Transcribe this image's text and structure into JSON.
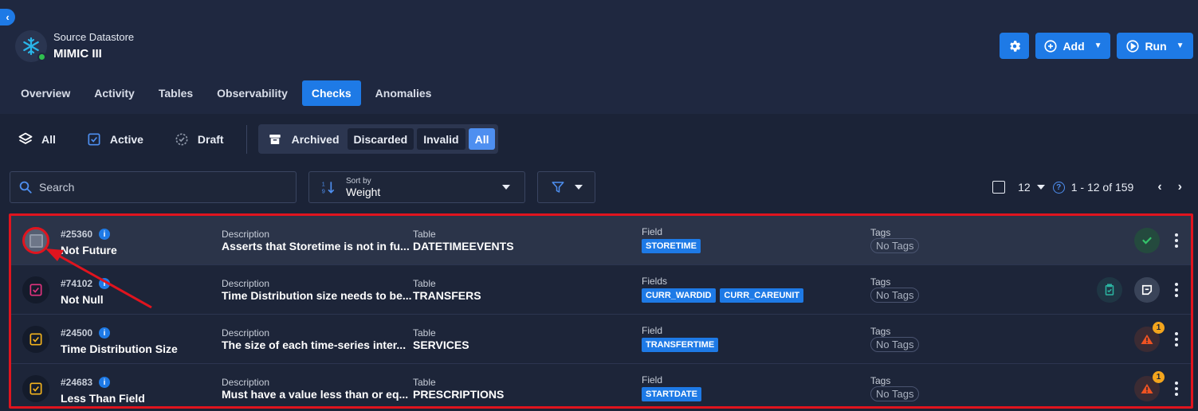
{
  "nav": {
    "back_icon": "chevron-left-icon"
  },
  "datastore": {
    "type_label": "Source Datastore",
    "name": "MIMIC III",
    "logo_icon": "snowflake-icon",
    "status_color": "#2fbf4f"
  },
  "actions": {
    "settings_icon": "gear-icon",
    "add_label": "Add",
    "run_label": "Run",
    "accent": "#1e7ae6"
  },
  "tabs": [
    {
      "label": "Overview"
    },
    {
      "label": "Activity"
    },
    {
      "label": "Tables"
    },
    {
      "label": "Observability"
    },
    {
      "label": "Checks",
      "active": true
    },
    {
      "label": "Anomalies"
    }
  ],
  "status_filters": {
    "all": "All",
    "active": "Active",
    "draft": "Draft",
    "archived": "Archived",
    "archived_options": [
      "Discarded",
      "Invalid",
      "All"
    ],
    "archived_selected": "All"
  },
  "search": {
    "placeholder": "Search"
  },
  "sort": {
    "caption": "Sort by",
    "value": "Weight"
  },
  "pagination": {
    "per_page": "12",
    "range": "1 - 12 of 159"
  },
  "checks": [
    {
      "id": "#25360",
      "name": "Not Future",
      "desc_label": "Description",
      "description": "Asserts that Storetime is not in fu...",
      "table_label": "Table",
      "table": "DATETIMEEVENTS",
      "field_label": "Field",
      "fields": [
        "STORETIME"
      ],
      "tags_label": "Tags",
      "tags": "No Tags",
      "status": "passed",
      "icon": "checkbox-icon"
    },
    {
      "id": "#74102",
      "name": "Not Null",
      "desc_label": "Description",
      "description": "Time Distribution size needs to be...",
      "table_label": "Table",
      "table": "TRANSFERS",
      "field_label": "Fields",
      "fields": [
        "CURR_WARDID",
        "CURR_CAREUNIT"
      ],
      "tags_label": "Tags",
      "tags": "No Tags",
      "status": "draft",
      "icon": "draft-check-icon"
    },
    {
      "id": "#24500",
      "name": "Time Distribution Size",
      "desc_label": "Description",
      "description": "The size of each time-series inter...",
      "table_label": "Table",
      "table": "SERVICES",
      "field_label": "Field",
      "fields": [
        "TRANSFERTIME"
      ],
      "tags_label": "Tags",
      "tags": "No Tags",
      "status": "anomaly",
      "anomaly_count": "1",
      "icon": "active-check-icon"
    },
    {
      "id": "#24683",
      "name": "Less Than Field",
      "desc_label": "Description",
      "description": "Must have a value less than or eq...",
      "table_label": "Table",
      "table": "PRESCRIPTIONS",
      "field_label": "Field",
      "fields": [
        "STARTDATE"
      ],
      "tags_label": "Tags",
      "tags": "No Tags",
      "status": "anomaly",
      "anomaly_count": "1",
      "icon": "active-check-icon"
    }
  ]
}
